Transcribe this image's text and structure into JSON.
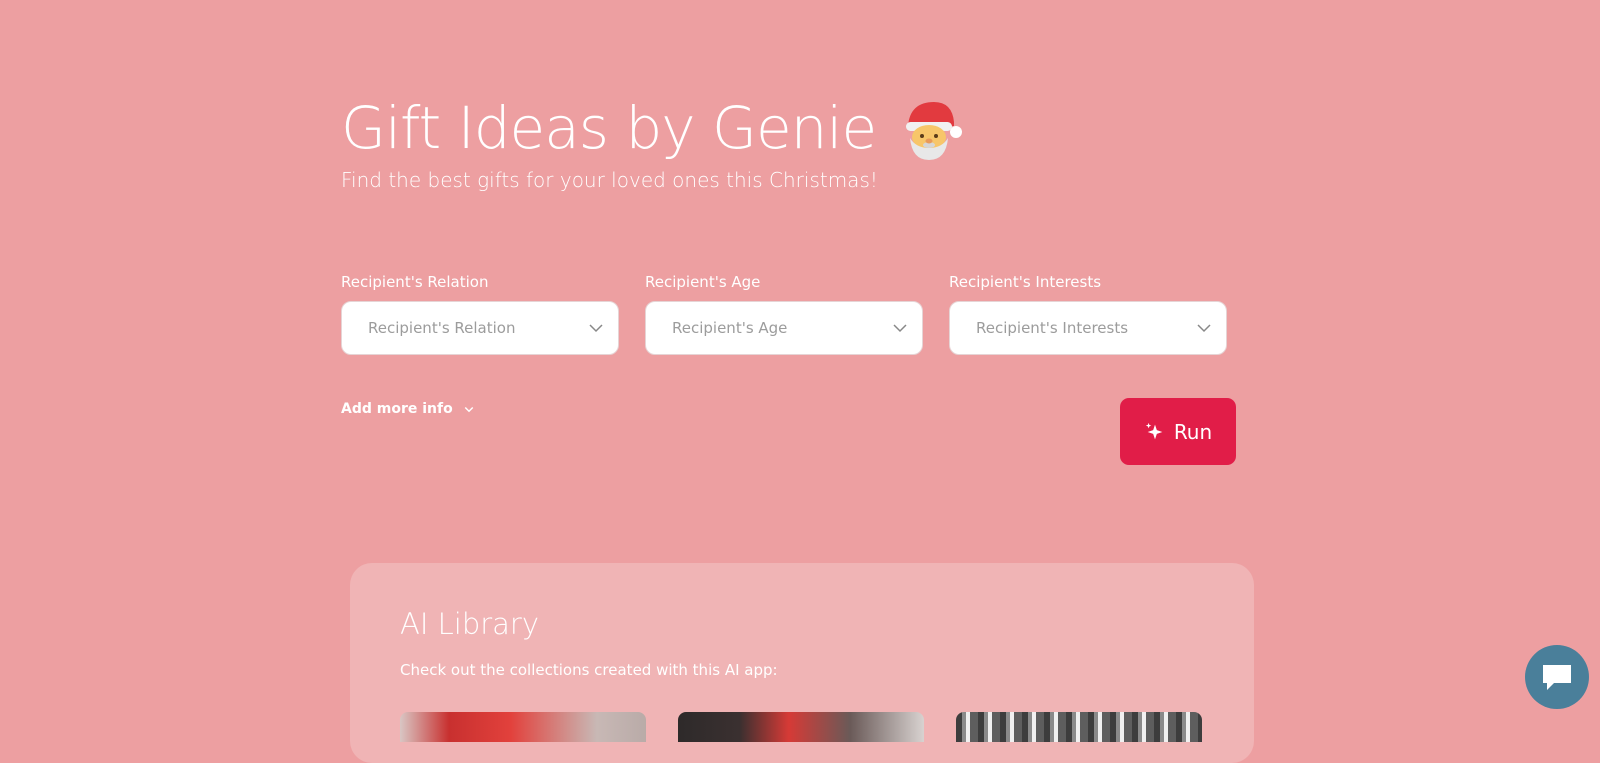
{
  "hero": {
    "title": "Gift Ideas by Genie",
    "title_emoji": "santa-claus",
    "subtitle": "Find the best gifts for your loved ones this Christmas!"
  },
  "form": {
    "fields": [
      {
        "label": "Recipient's Relation",
        "placeholder": "Recipient's Relation",
        "icon": "chevron-down-icon"
      },
      {
        "label": "Recipient's Age",
        "placeholder": "Recipient's Age",
        "icon": "chevron-down-icon"
      },
      {
        "label": "Recipient's Interests",
        "placeholder": "Recipient's Interests",
        "icon": "chevron-down-icon"
      }
    ],
    "more_info_label": "Add more info",
    "run_label": "Run",
    "run_icon": "sparkles-icon"
  },
  "library": {
    "title": "AI Library",
    "subtitle": "Check out the collections created with this AI app:"
  },
  "colors": {
    "background": "#ed9fa1",
    "run_button": "#e11d48",
    "library_panel": "#f0b4b5",
    "chat_button": "#4a7f9a"
  },
  "chat": {
    "icon": "chat-icon"
  }
}
